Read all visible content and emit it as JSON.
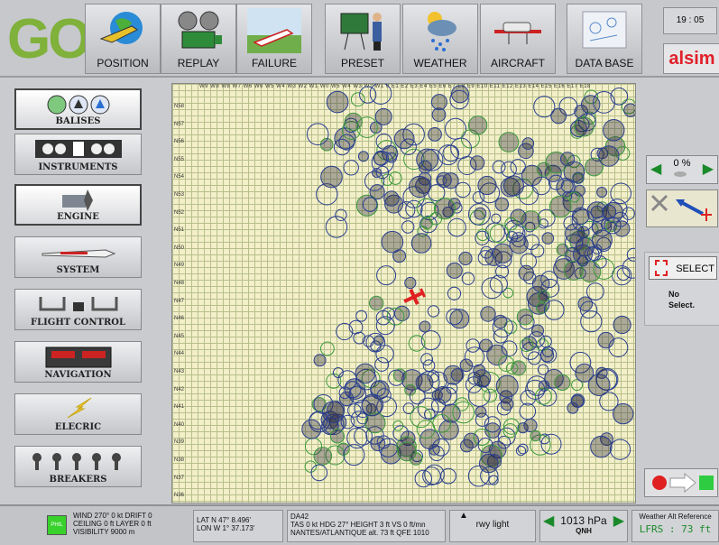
{
  "topbar": {
    "go_label": "GO",
    "buttons": [
      {
        "label": "POSITION",
        "icon": "plane-globe-icon"
      },
      {
        "label": "REPLAY",
        "icon": "film-projector-icon"
      },
      {
        "label": "FAILURE",
        "icon": "crashed-plane-icon"
      },
      {
        "label": "PRESET",
        "icon": "instructor-board-icon"
      },
      {
        "label": "WEATHER",
        "icon": "rain-cloud-icon"
      },
      {
        "label": "AIRCRAFT",
        "icon": "aircraft-icon"
      },
      {
        "label": "DATA BASE",
        "icon": "map-database-icon"
      }
    ],
    "clock": "19 : 05",
    "brand": "alsim"
  },
  "sidebar": {
    "items": [
      {
        "label": "BALISES",
        "icon": "beacons-icon"
      },
      {
        "label": "INSTRUMENTS",
        "icon": "instrument-panel-icon"
      },
      {
        "label": "ENGINE",
        "icon": "engine-icon"
      },
      {
        "label": "SYSTEM",
        "icon": "aircraft-system-icon"
      },
      {
        "label": "FLIGHT CONTROL",
        "icon": "yoke-icon"
      },
      {
        "label": "NAVIGATION",
        "icon": "nav-radio-icon"
      },
      {
        "label": "ELECRIC",
        "icon": "lightning-icon"
      },
      {
        "label": "BREAKERS",
        "icon": "breaker-icon"
      }
    ]
  },
  "map": {
    "lon_labels": "W9 W8 W8 W7 W6 W6 W5 W4 W3 W2 W1 W0 W5 W4 W3 W2 W1 0 E1 E2 E3 E4 E5 E6 E7 E8 E9 E10 E11 E12 E13 E14 E15 E16 E17 E18",
    "lat_labels": [
      "N58",
      "N57",
      "N56",
      "N55",
      "N54",
      "N53",
      "N52",
      "N51",
      "N50",
      "N49",
      "N48",
      "N47",
      "N46",
      "N45",
      "N44",
      "N43",
      "N42",
      "N41",
      "N40",
      "N39",
      "N38",
      "N37",
      "N36"
    ]
  },
  "right_panel": {
    "percent": "0 %",
    "select_label": "SELECT",
    "no_select": "No\nSelect."
  },
  "status": {
    "indicator": "PHIL",
    "weather": [
      "WIND 270° 0 kt DRIFT 0",
      "CEILING 0 ft LAYER 0 ft",
      "VISIBILITY 9000 m"
    ],
    "position": [
      "LAT N 47° 8.496'",
      "LON W 1° 37.173'"
    ],
    "aircraft": [
      "DA42",
      "TAS 0 kt HDG 27° HEIGHT 3 ft VS 0 ft/mn",
      "NANTES/ATLANTIQUE alt. 73 ft QFE 1010"
    ],
    "rwy_light": "rwy light",
    "qnh_value": "1013 hPa",
    "qnh_label": "QNH",
    "weather_alt_title": "Weather Alt Reference",
    "weather_alt_value": "LFRS : 73 ft"
  }
}
